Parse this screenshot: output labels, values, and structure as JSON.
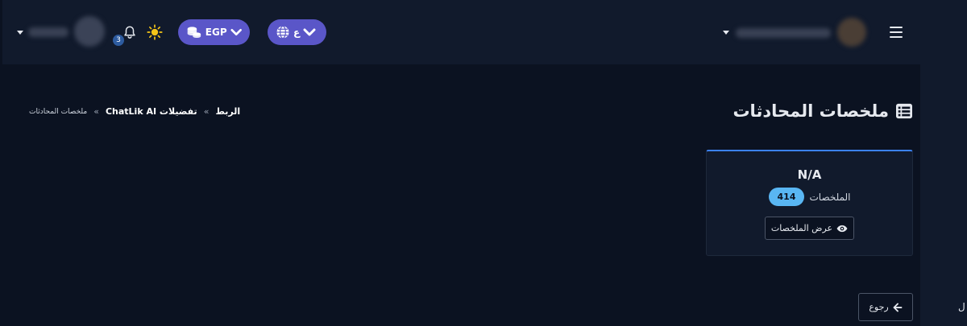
{
  "header": {
    "notification_count": "3",
    "currency_label": "EGP",
    "language_label": "ع"
  },
  "page": {
    "title": "ملخصات المحادثات"
  },
  "breadcrumb": {
    "items": [
      "الربط",
      "تفضيلات ChatLik AI",
      "ملخصات المحادثات"
    ],
    "separator": "»"
  },
  "card": {
    "title": "N/A",
    "count": "414",
    "count_label": "الملخصات",
    "view_button": "عرض الملخصات"
  },
  "back_button": "رجوع",
  "sidebar_fragment": "ل",
  "colors": {
    "background": "#0b1221",
    "topbar": "#111a2c",
    "pill": "#5a56c8",
    "accent": "#3b82f6",
    "badge": "#59b6f3",
    "sun": "#f5c518"
  }
}
